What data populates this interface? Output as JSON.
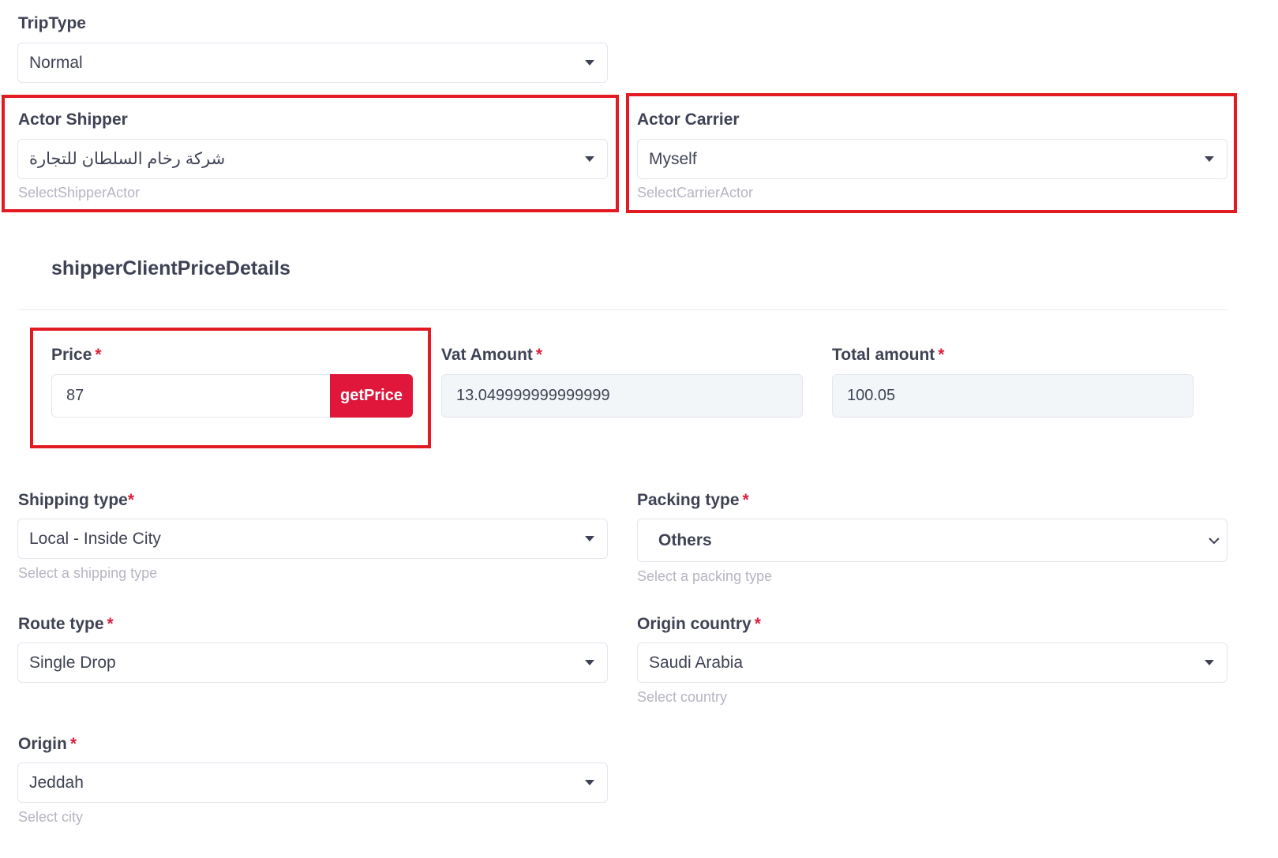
{
  "trip_type": {
    "label": "TripType",
    "value": "Normal"
  },
  "actor_shipper": {
    "label": "Actor Shipper",
    "value": "شركة رخام السلطان للتجارة",
    "help": "SelectShipperActor"
  },
  "actor_carrier": {
    "label": "Actor Carrier",
    "value": "Myself",
    "help": "SelectCarrierActor"
  },
  "section": {
    "title": "shipperClientPriceDetails"
  },
  "price": {
    "label": "Price",
    "value": "87",
    "button": "getPrice"
  },
  "vat_amount": {
    "label": "Vat Amount",
    "value": "13.049999999999999"
  },
  "total_amount": {
    "label": "Total amount",
    "value": "100.05"
  },
  "shipping_type": {
    "label": "Shipping type",
    "value": "Local - Inside City",
    "help": "Select a shipping type"
  },
  "packing_type": {
    "label": "Packing type",
    "value": "Others",
    "help": "Select a packing type"
  },
  "route_type": {
    "label": "Route type",
    "value": "Single Drop"
  },
  "origin_country": {
    "label": "Origin country",
    "value": "Saudi Arabia",
    "help": "Select country"
  },
  "origin": {
    "label": "Origin",
    "value": "Jeddah",
    "help": "Select city"
  },
  "required_mark": "*",
  "colors": {
    "accent": "#e0163b",
    "highlight": "#e21b23",
    "text": "#3f4254",
    "muted": "#b5b5c3"
  }
}
